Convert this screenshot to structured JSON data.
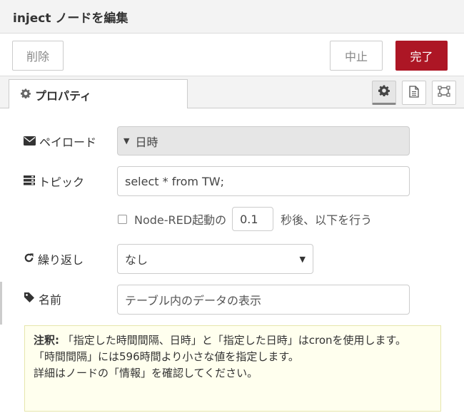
{
  "header": {
    "title": "inject ノードを編集"
  },
  "toolbar": {
    "delete_label": "削除",
    "cancel_label": "中止",
    "done_label": "完了"
  },
  "tabs": {
    "properties_label": "プロパティ"
  },
  "form": {
    "payload": {
      "label": "ペイロード",
      "value": "日時"
    },
    "topic": {
      "label": "トピック",
      "value": "select * from TW;"
    },
    "inject_once": {
      "prefix": "Node-RED起動の",
      "delay": "0.1",
      "suffix": "秒後、以下を行う"
    },
    "repeat": {
      "label": "繰り返し",
      "value": "なし"
    },
    "name": {
      "label": "名前",
      "value": "テーブル内のデータの表示"
    }
  },
  "tip": {
    "label": "注釈:",
    "line1": "「指定した時間間隔、日時」と「指定した日時」はcronを使用します。",
    "line2": "「時間間隔」には596時間より小さな値を指定します。",
    "line3": "詳細はノードの「情報」を確認してください。"
  },
  "colors": {
    "done_button": "#ad1625",
    "tip_bg": "#ffffee"
  },
  "icons": [
    "gear-icon",
    "envelope-icon",
    "topic-icon",
    "repeat-icon",
    "tag-icon",
    "description-icon",
    "appearance-icon",
    "caret-down-icon"
  ]
}
